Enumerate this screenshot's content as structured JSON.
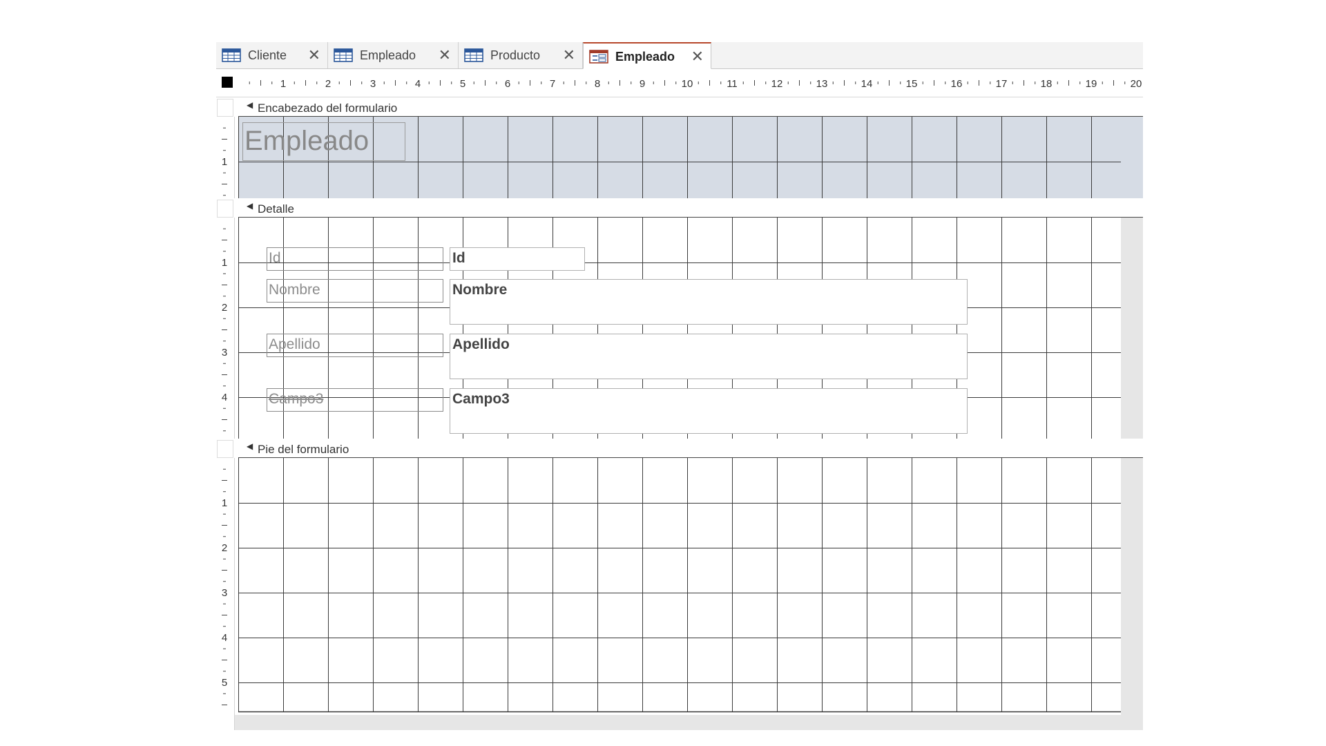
{
  "tabs": [
    {
      "label": "Cliente",
      "icon": "table-icon",
      "active": false
    },
    {
      "label": "Empleado",
      "icon": "table-icon",
      "active": false
    },
    {
      "label": "Producto",
      "icon": "table-icon",
      "active": false
    },
    {
      "label": "Empleado",
      "icon": "form-icon",
      "active": true
    }
  ],
  "close_glyph": "✕",
  "section_arrow": "◀",
  "ruler": {
    "horizontal_labels": [
      "1",
      "2",
      "3",
      "4",
      "5",
      "6",
      "7",
      "8",
      "9",
      "10",
      "11",
      "12",
      "13",
      "14",
      "15",
      "16",
      "17",
      "18",
      "19",
      "20"
    ],
    "header_labels": [
      "1"
    ],
    "detail_labels": [
      "1",
      "2",
      "3",
      "4"
    ],
    "footer_labels": [
      "1",
      "2",
      "3",
      "4",
      "5"
    ]
  },
  "sections": {
    "header": {
      "title": "Encabezado del formulario",
      "form_title": "Empleado"
    },
    "detail": {
      "title": "Detalle",
      "fields": [
        {
          "label": "Id",
          "value": "Id"
        },
        {
          "label": "Nombre",
          "value": "Nombre"
        },
        {
          "label": "Apellido",
          "value": "Apellido"
        },
        {
          "label": "Campo3",
          "value": "Campo3"
        }
      ]
    },
    "footer": {
      "title": "Pie del formulario"
    }
  },
  "colors": {
    "header_fill": "#d6dce5",
    "grid_line": "#3a3a3a",
    "active_tab_accent": "#b7472a",
    "outside_area": "#e6e6e6"
  }
}
